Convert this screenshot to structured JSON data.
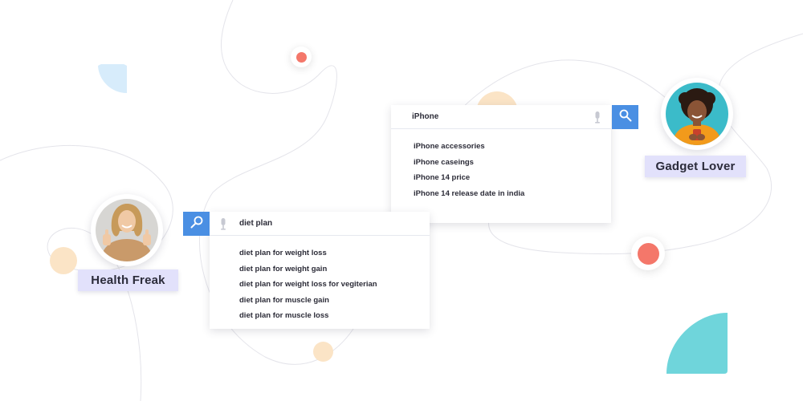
{
  "colors": {
    "search_button": "#4a8fe3",
    "tag_background": "#e2e1fb",
    "dot_coral": "#f4776a",
    "dot_beige": "#fbe4c6",
    "shape_teal": "#6fd5db",
    "shape_light_blue": "#d7ecfb"
  },
  "icons": {
    "search": "magnifier-icon",
    "voice": "microphone-icon"
  },
  "iphone_search": {
    "query": "iPhone",
    "suggestions": [
      "iPhone accessories",
      "iPhone caseings",
      "iPhone 14 price",
      "iPhone 14 release date in india"
    ]
  },
  "diet_search": {
    "query": "diet plan",
    "suggestions": [
      "diet plan for weight loss",
      "diet plan for weight gain",
      "diet plan for weight loss for vegiterian",
      "diet plan for muscle gain",
      "diet plan for muscle loss"
    ]
  },
  "personas": {
    "gadget_lover": {
      "label": "Gadget Lover"
    },
    "health_freak": {
      "label": "Health Freak"
    }
  }
}
